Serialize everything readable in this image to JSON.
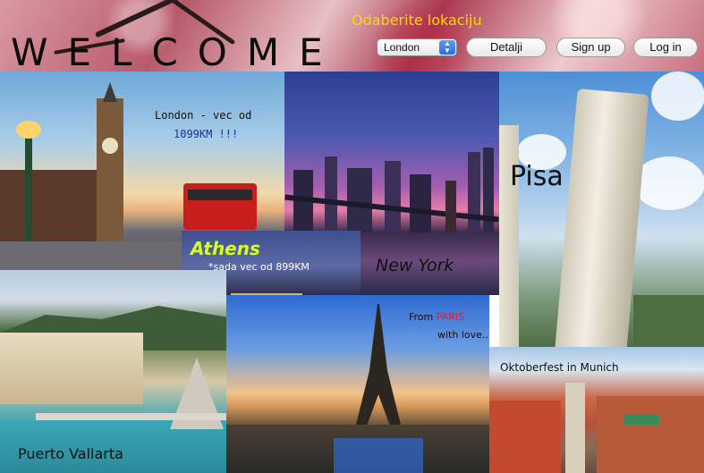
{
  "header": {
    "title": "WELCOME",
    "choose_label": "Odaberite lokaciju",
    "location_selected": "London",
    "details_button": "Detalji",
    "signup_button": "Sign up",
    "login_button": "Log in"
  },
  "tiles": {
    "london": {
      "line1": "London - vec od",
      "line2": "1099KM !!!"
    },
    "new_york": {
      "label": "New York"
    },
    "pisa": {
      "label": "Pisa"
    },
    "athens": {
      "label": "Athens",
      "sub": "*sada vec od 899KM"
    },
    "paris": {
      "prefix": "From ",
      "city": "PARIS",
      "line2": "with love..."
    },
    "puerto_vallarta": {
      "label": "Puerto Vallarta"
    },
    "munich": {
      "label": "Oktoberfest in Munich"
    }
  },
  "colors": {
    "choose_label": "#ffd400",
    "london_price": "#1a2fa0",
    "athens_label": "#d4ff2a",
    "paris_city": "#e0202a"
  }
}
